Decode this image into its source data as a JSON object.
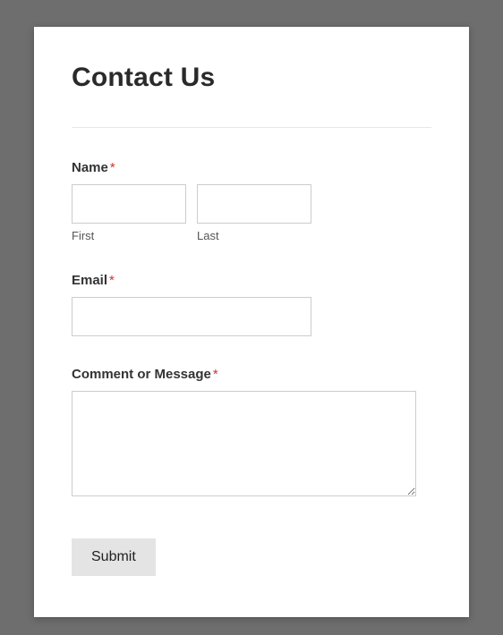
{
  "form": {
    "title": "Contact Us",
    "fields": {
      "name": {
        "label": "Name",
        "required_mark": "*",
        "first_sublabel": "First",
        "last_sublabel": "Last",
        "first_value": "",
        "last_value": ""
      },
      "email": {
        "label": "Email",
        "required_mark": "*",
        "value": ""
      },
      "message": {
        "label": "Comment or Message",
        "required_mark": "*",
        "value": ""
      }
    },
    "submit_label": "Submit"
  }
}
